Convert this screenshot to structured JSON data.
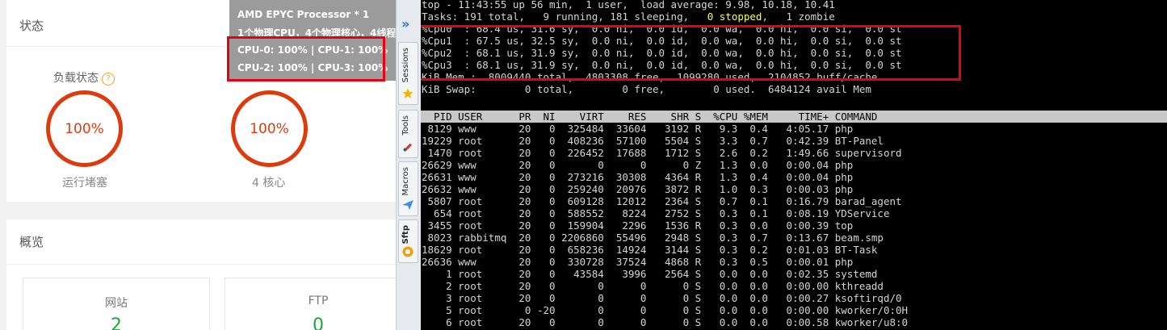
{
  "status_card": {
    "title": "状态",
    "load": {
      "label": "负载状态",
      "value": "100%",
      "caption": "运行堵塞"
    },
    "cpu": {
      "value": "100%",
      "caption": "4 核心"
    }
  },
  "tooltip": {
    "line1": "AMD EPYC Processor * 1",
    "line2": "1个物理CPU，4个物理核心，4线程",
    "line3": "CPU-0: 100% | CPU-1: 100%",
    "line4": "CPU-2: 100% | CPU-3: 100%"
  },
  "overview_card": {
    "title": "概览",
    "boxes": [
      {
        "title": "网站",
        "count": "2"
      },
      {
        "title": "FTP",
        "count": "0"
      }
    ]
  },
  "side_tabs": [
    "Sessions",
    "Tools",
    "Macros",
    "Sftp"
  ],
  "terminal": {
    "line_top": "top - 11:43:55 up 56 min,  1 user,  load average: 9.98, 10.18, 10.41",
    "line_tasks_a": "Tasks: 191 total,   9 running, 181 sleeping,   ",
    "line_tasks_stopped": "0 stopped",
    "line_tasks_b": ",   1 zombie",
    "cpu_lines": [
      "%Cpu0  : 68.4 us, 31.6 sy,  0.0 ni,  0.0 id,  0.0 wa,  0.0 hi,  0.0 si,  0.0 st",
      "%Cpu1  : 67.5 us, 32.5 sy,  0.0 ni,  0.0 id,  0.0 wa,  0.0 hi,  0.0 si,  0.0 st",
      "%Cpu2  : 68.1 us, 31.9 sy,  0.0 ni,  0.0 id,  0.0 wa,  0.0 hi,  0.0 si,  0.0 st",
      "%Cpu3  : 68.1 us, 31.9 sy,  0.0 ni,  0.0 id,  0.0 wa,  0.0 hi,  0.0 si,  0.0 st"
    ],
    "line_mem": "KiB Mem :  8009440 total,  4803308 free,  1099280 used,  2104852 buff/cache",
    "line_swap": "KiB Swap:        0 total,        0 free,        0 used.  6484124 avail Mem",
    "table_header": "  PID USER      PR  NI    VIRT    RES    SHR S  %CPU %MEM     TIME+ COMMAND",
    "rows": [
      " 8129 www       20   0  325484  33604   3192 R   9.3  0.4   4:05.17 php",
      "19229 root      20   0  408236  57100   5504 S   3.3  0.7   0:42.39 BT-Panel",
      " 1470 root      20   0  226452  17688   1712 S   2.6  0.2   1:49.66 supervisord",
      "26629 www       20   0       0      0      0 Z   1.3  0.0   0:00.04 php",
      "26631 www       20   0  273216  30308   4364 R   1.3  0.4   0:00.04 php",
      "26632 www       20   0  259240  20976   3872 R   1.0  0.3   0:00.03 php",
      " 5807 root      20   0  609128  12012   2364 S   0.7  0.1   0:16.79 barad_agent",
      "  654 root      20   0  588552   8224   2752 S   0.3  0.1   0:08.19 YDService",
      " 3455 root      20   0  159904   2296   1536 R   0.3  0.0   0:00.39 top",
      " 8023 rabbitmq  20   0 2206860  55496   2948 S   0.3  0.7   0:13.67 beam.smp",
      "18629 root      20   0  658236  14924   3144 S   0.3  0.2   0:01.03 BT-Task",
      "26636 www       20   0  330728  37524   4868 R   0.3  0.5   0:00.01 php",
      "    1 root      20   0   43584   3996   2564 S   0.0  0.0   0:02.35 systemd",
      "    2 root      20   0       0      0      0 S   0.0  0.0   0:00.00 kthreadd",
      "    3 root      20   0       0      0      0 S   0.0  0.0   0:00.27 ksoftirqd/0",
      "    5 root       0 -20       0      0      0 S   0.0  0.0   0:00.00 kworker/0:0H",
      "    6 root      20   0       0      0      0 S   0.0  0.0   0:00.58 kworker/u8:0"
    ]
  },
  "colors": {
    "gauge": "#dc3b10",
    "highlight_box": "#e60012",
    "count_green": "#20a53a"
  }
}
